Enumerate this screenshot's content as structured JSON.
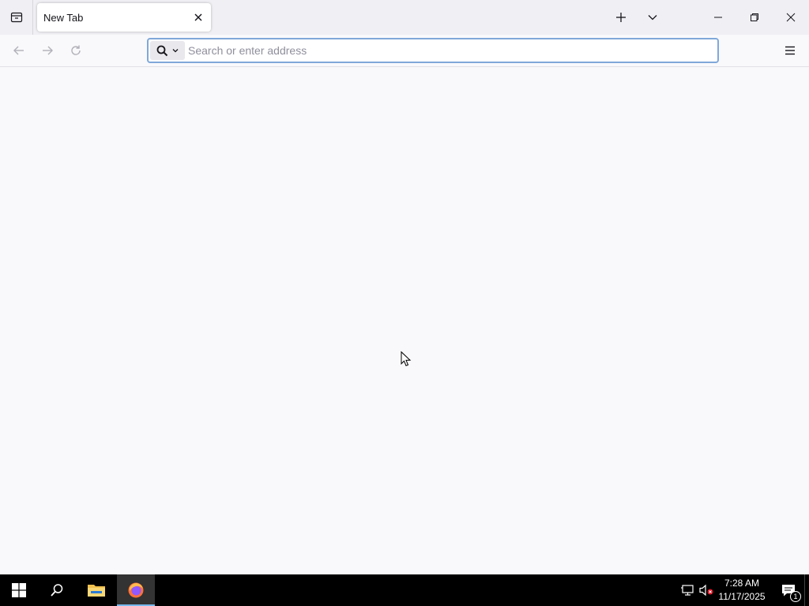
{
  "browser": {
    "tab": {
      "title": "New Tab"
    },
    "urlbar": {
      "placeholder": "Search or enter address",
      "value": ""
    }
  },
  "taskbar": {
    "clock": {
      "time": "7:28 AM",
      "date": "11/17/2025"
    },
    "notifications_count": "1"
  },
  "icons": {
    "tab_view": "tab-view-icon",
    "tab_close": "close-icon",
    "new_tab": "plus-icon",
    "tab_list": "chevron-down-icon",
    "minimize": "minimize-icon",
    "maximize": "restore-icon",
    "close": "close-icon",
    "back": "back-arrow-icon",
    "forward": "forward-arrow-icon",
    "reload": "reload-icon",
    "search_engine": "search-icon",
    "menu": "hamburger-menu-icon",
    "start": "windows-start-icon",
    "taskbar_search": "search-icon",
    "file_explorer": "folder-icon",
    "firefox": "firefox-icon",
    "network": "network-icon",
    "volume": "volume-muted-icon",
    "notifications": "notification-icon"
  },
  "colors": {
    "urlbar_focus_border": "#7fa8da",
    "taskbar_background": "#000000",
    "active_app_indicator": "#76b9ed",
    "content_background": "#f9f9fb"
  }
}
